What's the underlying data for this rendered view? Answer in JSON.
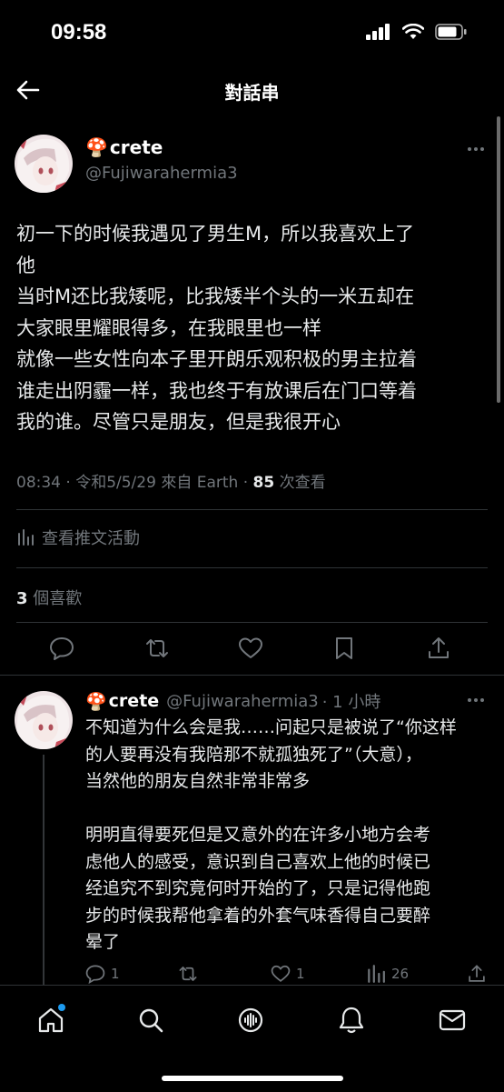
{
  "status": {
    "time": "09:58"
  },
  "nav": {
    "title": "對話串"
  },
  "tweet": {
    "author": {
      "emoji": "🍄",
      "name": "crete",
      "handle": "@Fujiwarahermia3"
    },
    "lines": [
      "初一下的时候我遇见了男生M，所以我喜欢上了",
      "他",
      "当时M还比我矮呢，比我矮半个头的一米五却在",
      "大家眼里耀眼得多，在我眼里也一样",
      "就像一些女性向本子里开朗乐观积极的男主拉着",
      "谁走出阴霾一样，我也终于有放课后在门口等着",
      "我的谁。尽管只是朋友，但是我很开心"
    ],
    "meta": {
      "prefix": "08:34 · 令和5/5/29 來自 Earth · ",
      "views": "85",
      "views_label": " 次查看"
    },
    "activity_label": "查看推文活動",
    "likes": {
      "count": "3",
      "label": " 個喜歡"
    }
  },
  "reply": {
    "author": {
      "emoji": "🍄",
      "name": "crete",
      "handle": "@Fujiwarahermia3",
      "time": "· 1 小時"
    },
    "lines": [
      "不知道为什么会是我……问起只是被说了“你这样",
      "的人要再没有我陪那不就孤独死了”（大意），",
      "当然他的朋友自然非常非常多",
      "",
      "明明直得要死但是又意外的在许多小地方会考",
      "虑他人的感受，意识到自己喜欢上他的时候已",
      "经追究不到究竟何时开始的了，只是记得他跑",
      "步的时候我帮他拿着的外套气味香得自己要醉",
      "晕了"
    ],
    "counts": {
      "replies": "1",
      "likes": "1",
      "views": "26"
    }
  },
  "icons": {
    "back": "arrow-left-icon",
    "more": "more-icon",
    "reply": "reply-icon",
    "retweet": "retweet-icon",
    "like": "heart-icon",
    "bookmark": "bookmark-icon",
    "share": "share-icon",
    "analytics": "bar-chart-icon",
    "home": "home-icon",
    "search": "search-icon",
    "spaces": "spaces-icon",
    "notifications": "bell-icon",
    "messages": "mail-icon"
  },
  "colors": {
    "background": "#000000",
    "text": "#e7e9ea",
    "secondary": "#71767b",
    "divider": "#2f3336",
    "accent": "#1d9bf0"
  }
}
